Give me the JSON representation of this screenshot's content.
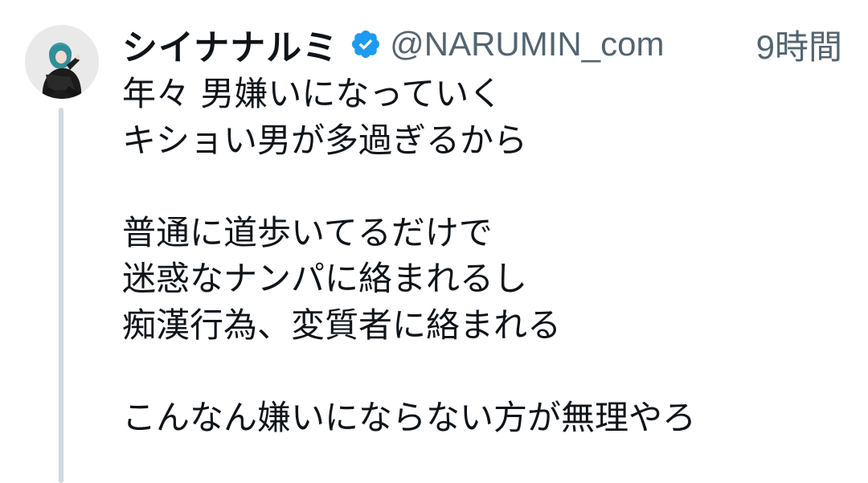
{
  "author": {
    "display_name": "シイナナルミ",
    "handle": "@NARUMIN_com",
    "verified": true
  },
  "timestamp": "9時間",
  "body_lines": [
    "年々 男嫌いになっていく",
    "キショい男が多過ぎるから",
    "",
    "普通に道歩いてるだけで",
    "迷惑なナンパに絡まれるし",
    "痴漢行為、変質者に絡まれる",
    "",
    "こんなん嫌いにならない方が無理やろ"
  ],
  "colors": {
    "verified_badge": "#1d9bf0",
    "secondary_text": "#536471",
    "thread_line": "#cfd9de"
  },
  "icons": {
    "avatar": "profile-photo",
    "verified": "verified-badge-icon"
  }
}
